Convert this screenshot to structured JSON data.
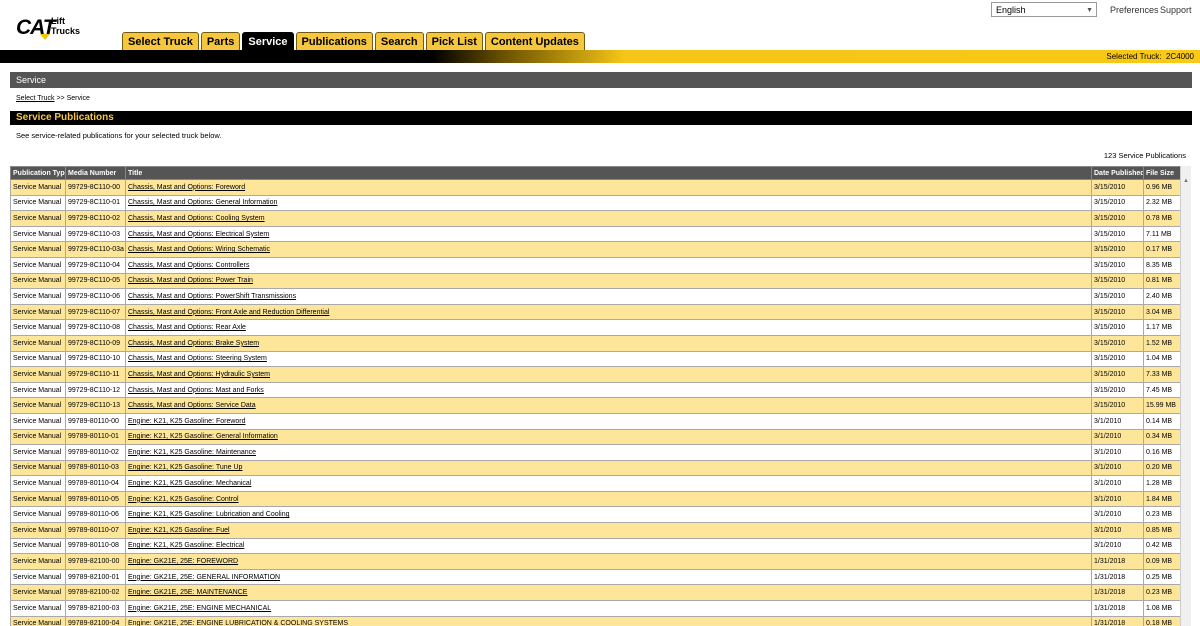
{
  "logo": {
    "brand": "CAT",
    "sub_line1": "Lift",
    "sub_line2": "Trucks"
  },
  "language": {
    "selected": "English"
  },
  "top_links": {
    "preferences": "Preferences",
    "support": "Support"
  },
  "tabs": [
    {
      "label": "Select Truck",
      "active": false
    },
    {
      "label": "Parts",
      "active": false
    },
    {
      "label": "Service",
      "active": true
    },
    {
      "label": "Publications",
      "active": false
    },
    {
      "label": "Search",
      "active": false
    },
    {
      "label": "Pick List",
      "active": false
    },
    {
      "label": "Content Updates",
      "active": false
    }
  ],
  "selected_truck": {
    "label": "Selected Truck:",
    "value": "2C4000"
  },
  "section_title": "Service",
  "breadcrumb": {
    "link": "Select Truck",
    "separator": ">>",
    "current": "Service"
  },
  "publications_title": "Service Publications",
  "intro": "See service-related publications for your selected truck below.",
  "count_text": "123 Service Publications",
  "columns": [
    "Publication Type",
    "Media Number",
    "Title",
    "Date Published",
    "File Size"
  ],
  "rows": [
    {
      "type": "Service Manual",
      "media": "99729-8C110-00",
      "title": "Chassis, Mast and Options: Foreword",
      "date": "3/15/2010",
      "size": "0.96 MB"
    },
    {
      "type": "Service Manual",
      "media": "99729-8C110-01",
      "title": "Chassis, Mast and Options: General Information",
      "date": "3/15/2010",
      "size": "2.32 MB"
    },
    {
      "type": "Service Manual",
      "media": "99729-8C110-02",
      "title": "Chassis, Mast and Options: Cooling System",
      "date": "3/15/2010",
      "size": "0.78 MB"
    },
    {
      "type": "Service Manual",
      "media": "99729-8C110-03",
      "title": "Chassis, Mast and Options: Electrical System",
      "date": "3/15/2010",
      "size": "7.11 MB"
    },
    {
      "type": "Service Manual",
      "media": "99729-8C110-03a",
      "title": "Chassis, Mast and Options: Wiring Schematic",
      "date": "3/15/2010",
      "size": "0.17 MB"
    },
    {
      "type": "Service Manual",
      "media": "99729-8C110-04",
      "title": "Chassis, Mast and Options: Controllers",
      "date": "3/15/2010",
      "size": "8.35 MB"
    },
    {
      "type": "Service Manual",
      "media": "99729-8C110-05",
      "title": "Chassis, Mast and Options: Power Train",
      "date": "3/15/2010",
      "size": "0.81 MB"
    },
    {
      "type": "Service Manual",
      "media": "99729-8C110-06",
      "title": "Chassis, Mast and Options: PowerShift Transmissions",
      "date": "3/15/2010",
      "size": "2.40 MB"
    },
    {
      "type": "Service Manual",
      "media": "99729-8C110-07",
      "title": "Chassis, Mast and Options: Front Axle and Reduction Differential",
      "date": "3/15/2010",
      "size": "3.04 MB"
    },
    {
      "type": "Service Manual",
      "media": "99729-8C110-08",
      "title": "Chassis, Mast and Options: Rear Axle",
      "date": "3/15/2010",
      "size": "1.17 MB"
    },
    {
      "type": "Service Manual",
      "media": "99729-8C110-09",
      "title": "Chassis, Mast and Options: Brake System",
      "date": "3/15/2010",
      "size": "1.52 MB"
    },
    {
      "type": "Service Manual",
      "media": "99729-8C110-10",
      "title": "Chassis, Mast and Options: Steering System",
      "date": "3/15/2010",
      "size": "1.04 MB"
    },
    {
      "type": "Service Manual",
      "media": "99729-8C110-11",
      "title": "Chassis, Mast and Options: Hydraulic System",
      "date": "3/15/2010",
      "size": "7.33 MB"
    },
    {
      "type": "Service Manual",
      "media": "99729-8C110-12",
      "title": "Chassis, Mast and Options: Mast and Forks",
      "date": "3/15/2010",
      "size": "7.45 MB"
    },
    {
      "type": "Service Manual",
      "media": "99729-8C110-13",
      "title": "Chassis, Mast and Options: Service Data",
      "date": "3/15/2010",
      "size": "15.99 MB"
    },
    {
      "type": "Service Manual",
      "media": "99789-80110-00",
      "title": "Engine: K21, K25 Gasoline: Foreword",
      "date": "3/1/2010",
      "size": "0.14 MB"
    },
    {
      "type": "Service Manual",
      "media": "99789-80110-01",
      "title": "Engine: K21, K25 Gasoline: General Information",
      "date": "3/1/2010",
      "size": "0.34 MB"
    },
    {
      "type": "Service Manual",
      "media": "99789-80110-02",
      "title": "Engine: K21, K25 Gasoline: Maintenance",
      "date": "3/1/2010",
      "size": "0.16 MB"
    },
    {
      "type": "Service Manual",
      "media": "99789-80110-03",
      "title": "Engine: K21, K25 Gasoline: Tune Up",
      "date": "3/1/2010",
      "size": "0.20 MB"
    },
    {
      "type": "Service Manual",
      "media": "99789-80110-04",
      "title": "Engine: K21, K25 Gasoline: Mechanical",
      "date": "3/1/2010",
      "size": "1.28 MB"
    },
    {
      "type": "Service Manual",
      "media": "99789-80110-05",
      "title": "Engine: K21, K25 Gasoline: Control",
      "date": "3/1/2010",
      "size": "1.84 MB"
    },
    {
      "type": "Service Manual",
      "media": "99789-80110-06",
      "title": "Engine: K21, K25 Gasoline: Lubrication and Cooling",
      "date": "3/1/2010",
      "size": "0.23 MB"
    },
    {
      "type": "Service Manual",
      "media": "99789-80110-07",
      "title": "Engine: K21, K25 Gasoline: Fuel",
      "date": "3/1/2010",
      "size": "0.85 MB"
    },
    {
      "type": "Service Manual",
      "media": "99789-80110-08",
      "title": "Engine: K21, K25 Gasoline: Electrical",
      "date": "3/1/2010",
      "size": "0.42 MB"
    },
    {
      "type": "Service Manual",
      "media": "99789-82100-00",
      "title": "Engine: GK21E, 25E: FOREWORD",
      "date": "1/31/2018",
      "size": "0.09 MB"
    },
    {
      "type": "Service Manual",
      "media": "99789-82100-01",
      "title": "Engine: GK21E, 25E: GENERAL INFORMATION",
      "date": "1/31/2018",
      "size": "0.25 MB"
    },
    {
      "type": "Service Manual",
      "media": "99789-82100-02",
      "title": "Engine: GK21E, 25E: MAINTENANCE",
      "date": "1/31/2018",
      "size": "0.23 MB"
    },
    {
      "type": "Service Manual",
      "media": "99789-82100-03",
      "title": "Engine: GK21E, 25E: ENGINE MECHANICAL",
      "date": "1/31/2018",
      "size": "1.08 MB"
    },
    {
      "type": "Service Manual",
      "media": "99789-82100-04",
      "title": "Engine: GK21E, 25E: ENGINE LUBRICATION & COOLING SYSTEMS",
      "date": "1/31/2018",
      "size": "0.18 MB"
    }
  ],
  "colors": {
    "accent_yellow": "#f6c73c",
    "row_highlight": "#fde69a",
    "header_grey": "#555555"
  }
}
